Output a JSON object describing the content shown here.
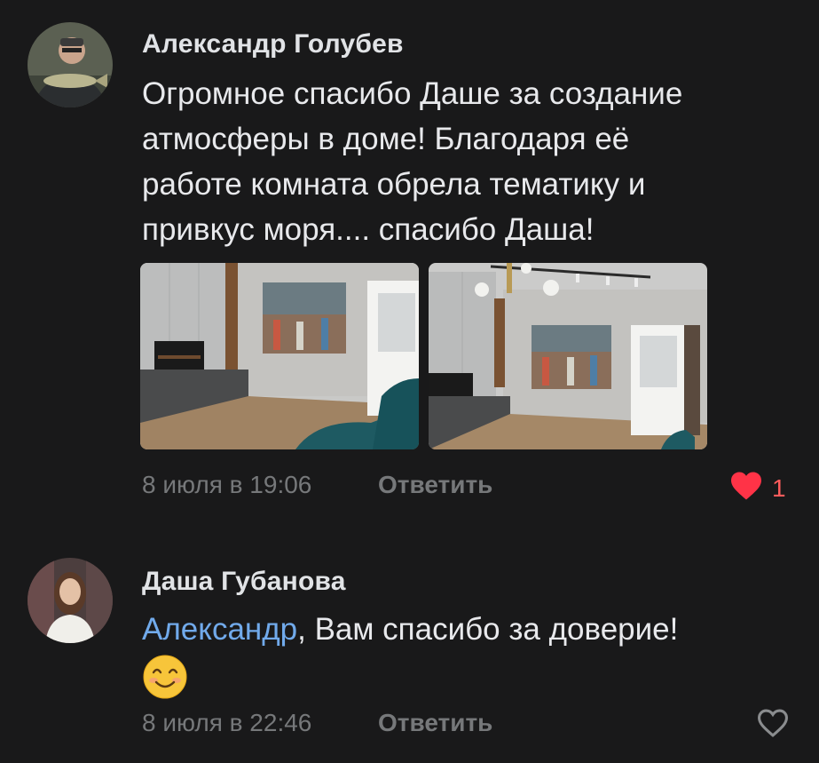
{
  "comments": [
    {
      "author": "Александр Голубев",
      "text_lines": [
        "Огромное спасибо Даше за создание",
        "атмосферы в доме! Благодаря её",
        "работе комната обрела тематику и",
        "привкус моря.... спасибо Даша!"
      ],
      "photos": [
        {
          "icon": "living-room-photo"
        },
        {
          "icon": "living-room-photo"
        }
      ],
      "timestamp": "8 июля в 19:06",
      "reply_label": "Ответить",
      "likes": "1",
      "liked": true,
      "like_color": "#ff3347"
    },
    {
      "author": "Даша Губанова",
      "mention": "Александр",
      "text_rest": ", Вам спасибо за доверие!",
      "emoji": "😊",
      "timestamp": "8 июля в 22:46",
      "reply_label": "Ответить",
      "liked": false
    }
  ],
  "colors": {
    "background": "#19191a",
    "text": "#e1e3e6",
    "secondary": "#76787a",
    "mention": "#71aaeb",
    "like": "#ff3347"
  }
}
